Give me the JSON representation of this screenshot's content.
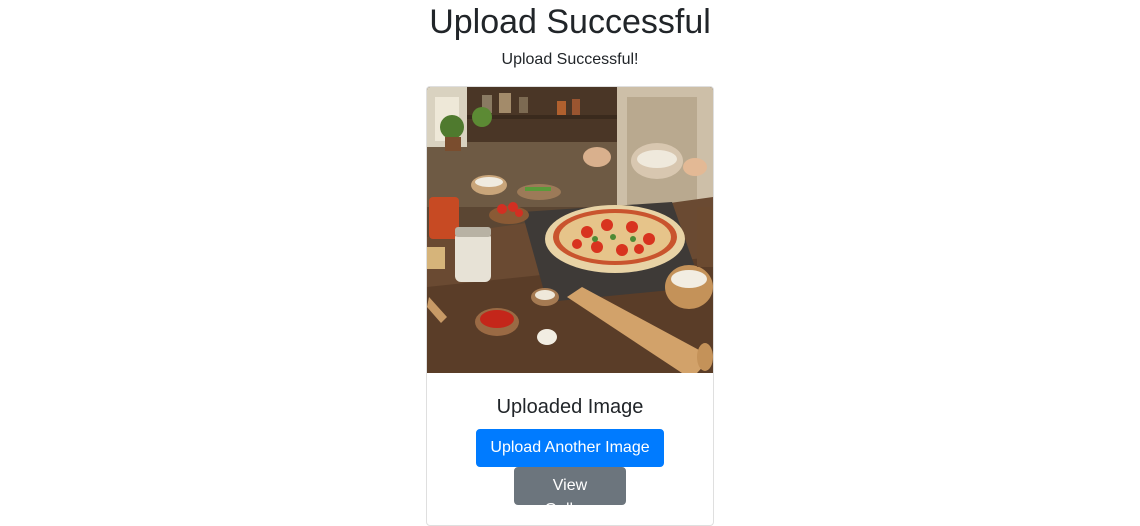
{
  "page": {
    "title": "Upload Successful",
    "status_message": "Upload Successful!"
  },
  "card": {
    "image_alt": "Pizza being prepared on a rustic kitchen table",
    "title": "Uploaded Image",
    "upload_another_label": "Upload Another Image",
    "view_gallery_label": "View Gallery"
  },
  "colors": {
    "primary": "#007bff",
    "secondary": "#6c757d",
    "text": "#212529"
  }
}
